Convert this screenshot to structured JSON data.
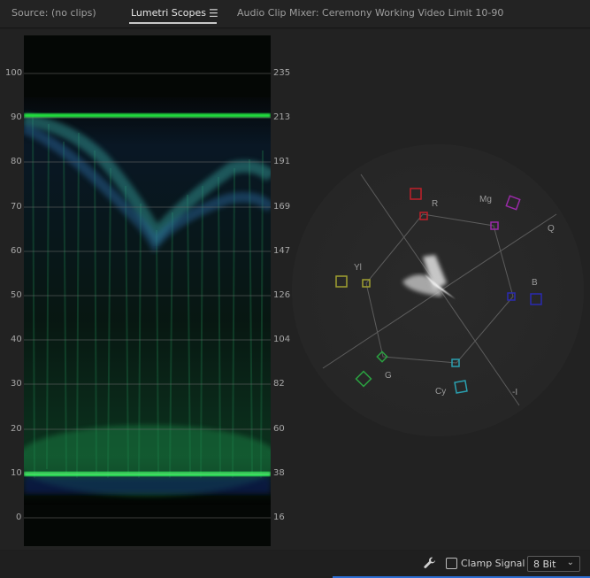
{
  "tabs": [
    {
      "label": "Source: (no clips)",
      "active": false
    },
    {
      "label": "Lumetri Scopes",
      "active": true
    },
    {
      "label": "Audio Clip Mixer: Ceremony Working Video Limit 10-90",
      "active": false
    }
  ],
  "waveform": {
    "left_scale": [
      "100",
      "90",
      "80",
      "70",
      "60",
      "50",
      "40",
      "30",
      "20",
      "10",
      "0"
    ],
    "right_scale": [
      "235",
      "213",
      "191",
      "169",
      "147",
      "126",
      "104",
      "82",
      "60",
      "38",
      "16"
    ]
  },
  "vectorscope": {
    "labels": [
      "R",
      "Mg",
      "Q",
      "B",
      "-I",
      "Cy",
      "G",
      "Yl"
    ],
    "target_colors": {
      "R": "#c0202a",
      "Mg": "#9a2aa8",
      "B": "#2a2ab0",
      "Cy": "#2aa0b0",
      "G": "#2aa040",
      "Yl": "#a0a030"
    }
  },
  "bottom": {
    "clamp_label": "Clamp Signal",
    "clamp_checked": false,
    "bit_depth": "8 Bit"
  },
  "icons": {
    "menu": "hamburger-menu-icon",
    "settings": "wrench-icon",
    "dropdown": "chevron-down-icon"
  },
  "colors": {
    "accent": "#2d6ed3",
    "waveform_green": "#22e040",
    "waveform_blue": "#2040c0"
  }
}
